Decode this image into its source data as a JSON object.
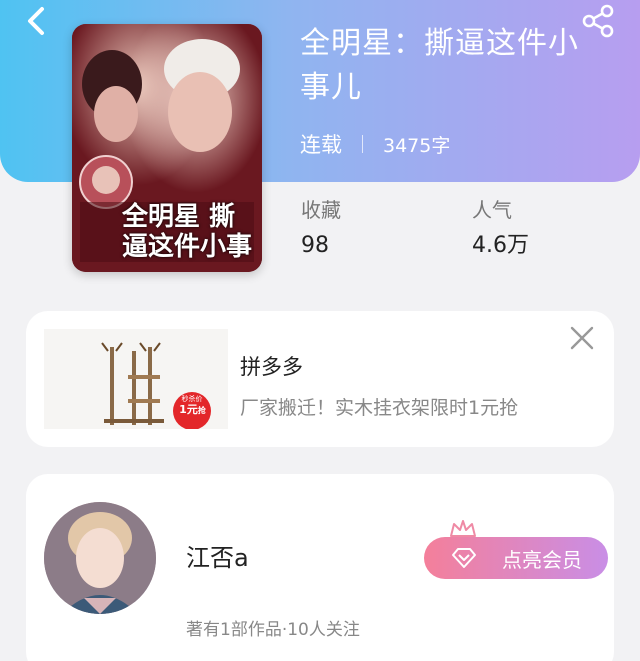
{
  "header": {
    "back_icon": "chevron-left-icon",
    "share_icon": "share-icon",
    "gradient": [
      "#4fc3f2",
      "#b79ef0"
    ]
  },
  "book": {
    "title": "全明星：撕逼这件小事儿",
    "status": "连载",
    "word_count": "3475字",
    "cover_text": "全明星 撕逼这件小事"
  },
  "stats": [
    {
      "label": "收藏",
      "value": "98"
    },
    {
      "label": "人气",
      "value": "4.6万"
    }
  ],
  "ad": {
    "title": "拼多多",
    "description": "厂家搬迁！实木挂衣架限时1元抢",
    "badge_label": "秒杀价",
    "price": "1元",
    "price_suffix": "抢",
    "close_icon": "close-icon"
  },
  "author": {
    "name": "江否a",
    "meta": "著有1部作品·10人关注",
    "vip_button_label": "点亮会员",
    "vip_icon": "diamond-icon",
    "crown_icon": "crown-icon",
    "vip_gradient": [
      "#f47f9a",
      "#c98ee6"
    ]
  }
}
